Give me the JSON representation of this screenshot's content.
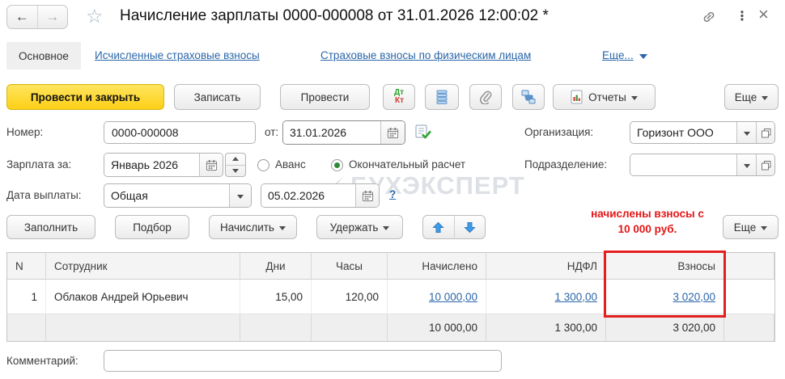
{
  "colors": {
    "accent_yellow": "#FDD017",
    "link_blue": "#2A66A9",
    "alert_red": "#E31717",
    "radio_green": "#2F8A35",
    "header_gray": "#F4F4F4"
  },
  "titlebar": {
    "title": "Начисление зарплаты 0000-000008 от 31.01.2026 12:00:02 *",
    "back_icon": "←",
    "forward_icon": "→",
    "star_icon": "☆",
    "dots_icon": "⋮",
    "close_icon": "×"
  },
  "tabs": {
    "main": "Основное",
    "calc_contributions": "Исчисленные страховые взносы",
    "contributions_individuals": "Страховые взносы по физическим лицам",
    "more": "Еще..."
  },
  "toolbar": {
    "post_close": "Провести и закрыть",
    "save": "Записать",
    "post": "Провести",
    "dt": "Дт",
    "kt": "Кт",
    "reports": "Отчеты",
    "more": "Еще"
  },
  "form": {
    "number_label": "Номер:",
    "number_value": "0000-000008",
    "from_label": "от:",
    "doc_date": "31.01.2026",
    "org_label": "Организация:",
    "org_value": "Горизонт ООО",
    "period_label": "Зарплата за:",
    "period_value": "Январь 2026",
    "advance_label": "Аванс",
    "final_label": "Окончательный расчет",
    "department_label": "Подразделение:",
    "department_value": "",
    "pay_date_label": "Дата выплаты:",
    "pay_kind_value": "Общая",
    "pay_date_value": "05.02.2026",
    "help": "?"
  },
  "grid_toolbar": {
    "fill": "Заполнить",
    "pick": "Подбор",
    "accrue": "Начислить",
    "withhold": "Удержать",
    "more": "Еще",
    "note_line1": "начислены взносы с",
    "note_line2": "10 000 руб."
  },
  "table": {
    "headers": [
      "N",
      "Сотрудник",
      "Дни",
      "Часы",
      "Начислено",
      "НДФЛ",
      "Взносы"
    ],
    "rows": [
      {
        "n": "1",
        "employee": "Облаков Андрей Юрьевич",
        "days": "15,00",
        "hours": "120,00",
        "accrued": "10 000,00",
        "ndfl": "1 300,00",
        "contrib": "3 020,00"
      }
    ],
    "totals": {
      "accrued": "10 000,00",
      "ndfl": "1 300,00",
      "contrib": "3 020,00"
    }
  },
  "comment": {
    "label": "Комментарий:"
  },
  "watermark": "БУХЭКСПЕРТ"
}
